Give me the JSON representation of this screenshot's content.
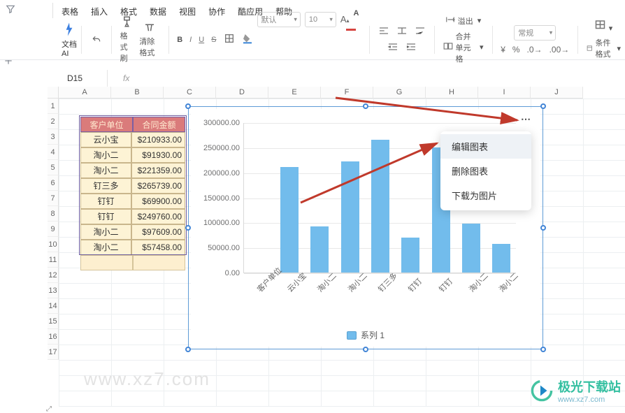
{
  "menu": {
    "items": [
      "表格",
      "插入",
      "格式",
      "数据",
      "视图",
      "协作",
      "酷应用",
      "帮助"
    ]
  },
  "ribbon": {
    "doc_ai": "文档AI",
    "fmt_brush": "格式刷",
    "clear_fmt": "清除格式",
    "font_family_placeholder": "默认",
    "font_size": "10",
    "overflow": "溢出",
    "merge_cells": "合并单元格",
    "number_fmt": "常规",
    "cond_fmt": "条件格式",
    "yen": "¥",
    "pct": "%"
  },
  "name_box": "D15",
  "data_table": {
    "headers": [
      "客户单位",
      "合同金额"
    ],
    "rows": [
      [
        "云小宝",
        "$210933.00"
      ],
      [
        "淘小二",
        "$91930.00"
      ],
      [
        "淘小二",
        "$221359.00"
      ],
      [
        "钉三多",
        "$265739.00"
      ],
      [
        "钉钉",
        "$69900.00"
      ],
      [
        "钉钉",
        "$249760.00"
      ],
      [
        "淘小二",
        "$97609.00"
      ],
      [
        "淘小二",
        "$57458.00"
      ]
    ]
  },
  "columns": [
    "A",
    "B",
    "C",
    "D",
    "E",
    "F",
    "G",
    "H",
    "I",
    "J"
  ],
  "rows_shown": 17,
  "context_menu": {
    "items": [
      "编辑图表",
      "删除图表",
      "下载为图片"
    ]
  },
  "watermark": "www.xz7.com",
  "brand": {
    "main": "极光下载站",
    "sub": "www.xz7.com"
  },
  "chart_data": {
    "type": "bar",
    "categories": [
      "客户单位",
      "云小宝",
      "淘小二",
      "淘小二",
      "钉三多",
      "钉钉",
      "钉钉",
      "淘小二",
      "淘小二"
    ],
    "values": [
      0,
      210933,
      91930,
      221359,
      265739,
      69900,
      249760,
      97609,
      57458
    ],
    "legend": "系列 1",
    "ymax": 300000,
    "ystep": 50000,
    "yticks": [
      "0.00",
      "50000.00",
      "100000.00",
      "150000.00",
      "200000.00",
      "250000.00",
      "300000.00"
    ]
  }
}
